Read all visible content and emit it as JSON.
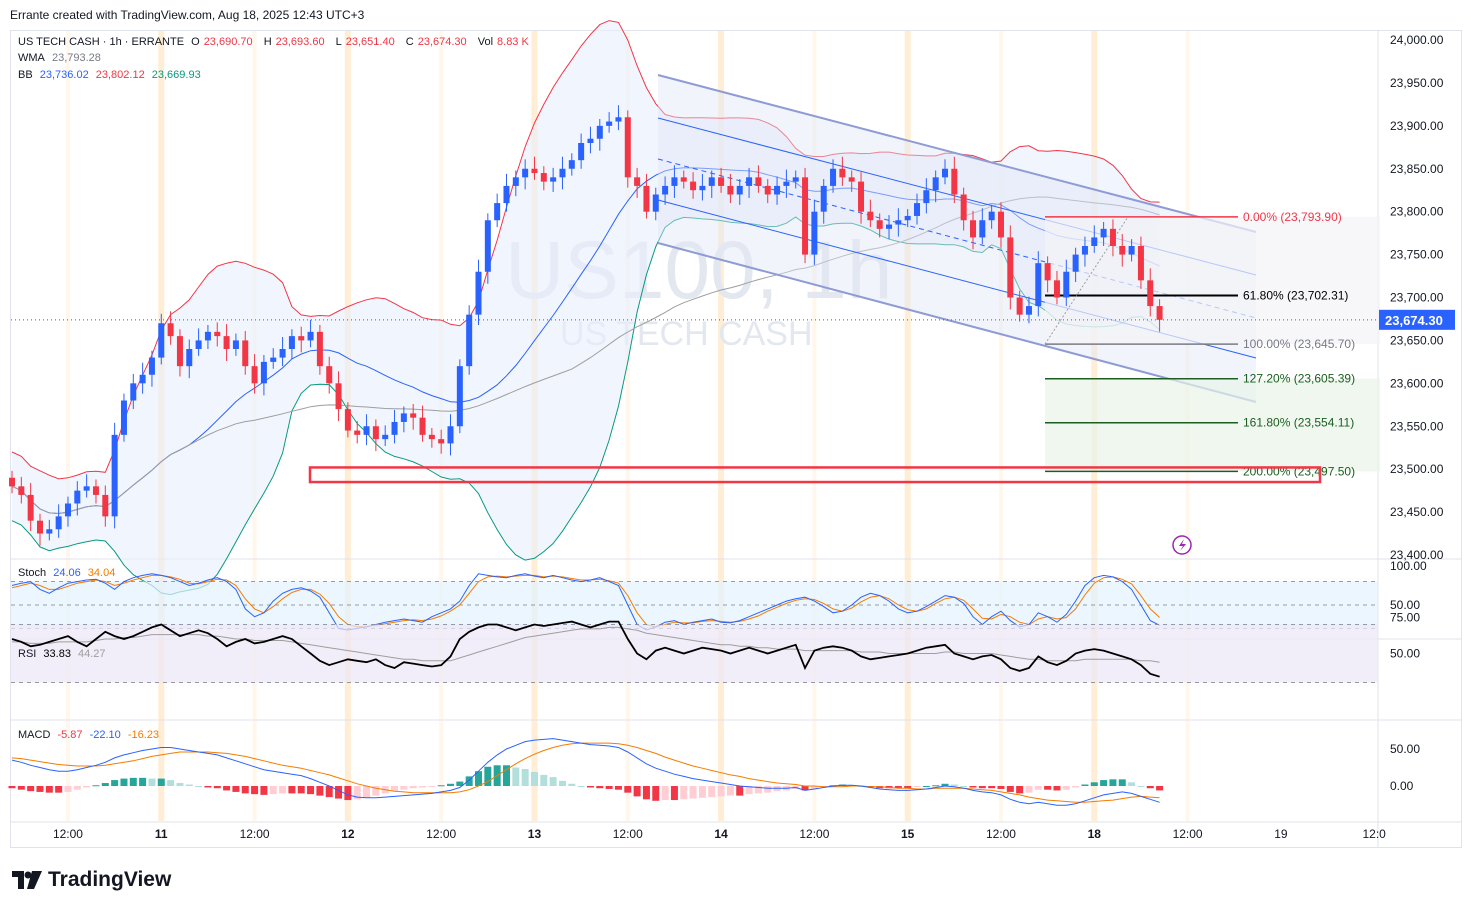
{
  "credit": "Errante created with TradingView.com, Aug 18, 2025 12:43 UTC+3",
  "brand": "TradingView",
  "watermark": {
    "symbol": "US100, 1h",
    "name": "US TECH CASH"
  },
  "legend": {
    "title": "US TECH CASH · 1h · ERRANTE",
    "open_label": "O",
    "open": "23,690.70",
    "high_label": "H",
    "high": "23,693.60",
    "low_label": "L",
    "low": "23,651.40",
    "close_label": "C",
    "close": "23,674.30",
    "vol_label": "Vol",
    "vol": "8.83 K",
    "wma_label": "WMA",
    "wma": "23,793.28",
    "bb_label": "BB",
    "bb_mid": "23,736.02",
    "bb_upper": "23,802.12",
    "bb_lower": "23,669.93",
    "stoch_label": "Stoch",
    "stoch_k": "24.06",
    "stoch_d": "34.04",
    "rsi_label": "RSI",
    "rsi": "33.83",
    "rsi_ma": "44.27",
    "macd_label": "MACD",
    "macd_hist": "-5.87",
    "macd_line": "-22.10",
    "macd_signal": "-16.23"
  },
  "colors": {
    "up": "#2962ff",
    "down": "#f23645",
    "bb_upper": "#f23645",
    "bb_mid": "#2962ff",
    "bb_lower": "#089981",
    "wma": "#9e9e9e",
    "channel": "#8e9bd4",
    "fib_red": "#f23645",
    "fib_black": "#000000",
    "fib_gray": "#787b86",
    "fib_green": "#1b5e20",
    "stoch_k": "#2962ff",
    "stoch_d": "#f57c00",
    "rsi": "#000000",
    "rsi_ma": "#9e9e9e",
    "macd_line": "#2962ff",
    "macd_signal": "#f57c00",
    "hist_pos_strong": "#26a69a",
    "hist_pos_weak": "#b2dfdb",
    "hist_neg_strong": "#f23645",
    "hist_neg_weak": "#ffcdd2",
    "price_tag": "#2962ff",
    "session": "#ffe0b2"
  },
  "price_tag": "23,674.30",
  "chart_data": {
    "type": "candlestick",
    "timeframe": "1h",
    "ylim": [
      23400,
      24000
    ],
    "price_ticks": [
      "24,000.00",
      "23,950.00",
      "23,900.00",
      "23,850.00",
      "23,800.00",
      "23,750.00",
      "23,700.00",
      "23,650.00",
      "23,600.00",
      "23,550.00",
      "23,500.00",
      "23,450.00",
      "23,400.00"
    ],
    "price_tick_values": [
      24000,
      23950,
      23900,
      23850,
      23800,
      23750,
      23700,
      23650,
      23600,
      23550,
      23500,
      23450,
      23400
    ],
    "time_labels": [
      {
        "label": "12:00",
        "i": 6,
        "bold": false
      },
      {
        "label": "11",
        "i": 16,
        "bold": true
      },
      {
        "label": "12:00",
        "i": 26,
        "bold": false
      },
      {
        "label": "12",
        "i": 36,
        "bold": true
      },
      {
        "label": "12:00",
        "i": 46,
        "bold": false
      },
      {
        "label": "13",
        "i": 56,
        "bold": true
      },
      {
        "label": "12:00",
        "i": 66,
        "bold": false
      },
      {
        "label": "14",
        "i": 76,
        "bold": true
      },
      {
        "label": "12:00",
        "i": 86,
        "bold": false
      },
      {
        "label": "15",
        "i": 96,
        "bold": true
      },
      {
        "label": "12:00",
        "i": 106,
        "bold": false
      },
      {
        "label": "18",
        "i": 116,
        "bold": true
      },
      {
        "label": "12:00",
        "i": 126,
        "bold": false
      },
      {
        "label": "19",
        "i": 136,
        "bold": false
      },
      {
        "label": "12:0",
        "i": 146,
        "bold": false
      }
    ],
    "closes": [
      23480,
      23470,
      23440,
      23425,
      23430,
      23445,
      23460,
      23475,
      23480,
      23470,
      23445,
      23540,
      23580,
      23600,
      23610,
      23630,
      23670,
      23655,
      23620,
      23640,
      23650,
      23660,
      23655,
      23640,
      23650,
      23620,
      23600,
      23625,
      23630,
      23640,
      23655,
      23650,
      23660,
      23620,
      23600,
      23570,
      23545,
      23540,
      23550,
      23535,
      23540,
      23555,
      23565,
      23560,
      23540,
      23535,
      23530,
      23550,
      23620,
      23680,
      23730,
      23790,
      23810,
      23830,
      23840,
      23850,
      23845,
      23835,
      23840,
      23850,
      23860,
      23880,
      23885,
      23900,
      23905,
      23910,
      23840,
      23830,
      23800,
      23820,
      23830,
      23840,
      23835,
      23825,
      23830,
      23840,
      23830,
      23820,
      23830,
      23840,
      23830,
      23820,
      23830,
      23835,
      23840,
      23750,
      23800,
      23830,
      23850,
      23840,
      23835,
      23800,
      23790,
      23780,
      23785,
      23790,
      23795,
      23810,
      23825,
      23840,
      23850,
      23820,
      23790,
      23770,
      23790,
      23800,
      23770,
      23700,
      23680,
      23690,
      23740,
      23720,
      23700,
      23730,
      23750,
      23760,
      23770,
      23780,
      23760,
      23750,
      23760,
      23720,
      23690,
      23674
    ],
    "fib_levels": [
      {
        "label": "0.00% (23,793.90)",
        "value": 23793.9,
        "color": "red"
      },
      {
        "label": "61.80% (23,702.31)",
        "value": 23702.31,
        "color": "black"
      },
      {
        "label": "100.00% (23,645.70)",
        "value": 23645.7,
        "color": "gray"
      },
      {
        "label": "127.20% (23,605.39)",
        "value": 23605.39,
        "color": "green"
      },
      {
        "label": "161.80% (23,554.11)",
        "value": 23554.11,
        "color": "green"
      },
      {
        "label": "200.00% (23,497.50)",
        "value": 23497.5,
        "color": "green"
      }
    ],
    "support_zone": [
      23485,
      23502
    ],
    "stoch_ticks": [
      "100.00",
      "50.00"
    ],
    "rsi_ticks": [
      "75.00",
      "50.00"
    ],
    "macd_ticks": [
      "50.00",
      "0.00"
    ],
    "stoch_k": [
      75,
      78,
      80,
      70,
      65,
      72,
      78,
      80,
      82,
      83,
      78,
      70,
      80,
      85,
      88,
      90,
      88,
      85,
      80,
      75,
      78,
      82,
      85,
      80,
      70,
      45,
      35,
      40,
      55,
      65,
      70,
      72,
      68,
      60,
      40,
      20,
      18,
      20,
      22,
      25,
      28,
      30,
      32,
      30,
      28,
      35,
      40,
      45,
      55,
      75,
      90,
      88,
      86,
      85,
      88,
      90,
      87,
      85,
      88,
      85,
      82,
      80,
      82,
      85,
      80,
      75,
      50,
      25,
      18,
      22,
      28,
      30,
      25,
      28,
      30,
      32,
      28,
      27,
      30,
      35,
      40,
      45,
      50,
      55,
      58,
      60,
      55,
      48,
      40,
      42,
      50,
      60,
      65,
      62,
      55,
      45,
      40,
      42,
      48,
      55,
      62,
      60,
      52,
      35,
      25,
      35,
      42,
      30,
      22,
      25,
      40,
      35,
      28,
      38,
      55,
      75,
      85,
      88,
      86,
      80,
      70,
      50,
      30,
      24
    ],
    "stoch_d": [
      72,
      75,
      78,
      75,
      70,
      70,
      74,
      78,
      80,
      82,
      80,
      75,
      78,
      82,
      85,
      88,
      88,
      86,
      83,
      78,
      77,
      80,
      83,
      82,
      75,
      58,
      45,
      40,
      48,
      58,
      66,
      70,
      70,
      64,
      52,
      35,
      25,
      22,
      22,
      24,
      26,
      28,
      30,
      31,
      30,
      32,
      36,
      42,
      50,
      65,
      80,
      86,
      87,
      86,
      87,
      88,
      88,
      86,
      87,
      86,
      84,
      82,
      82,
      83,
      81,
      78,
      62,
      40,
      25,
      22,
      25,
      28,
      27,
      27,
      29,
      30,
      29,
      28,
      29,
      32,
      36,
      42,
      47,
      52,
      56,
      58,
      57,
      52,
      45,
      42,
      46,
      54,
      60,
      62,
      58,
      50,
      44,
      42,
      45,
      52,
      58,
      60,
      56,
      45,
      33,
      32,
      38,
      35,
      28,
      25,
      32,
      35,
      32,
      34,
      45,
      63,
      78,
      85,
      86,
      83,
      77,
      62,
      45,
      34
    ],
    "rsi": [
      60,
      58,
      55,
      56,
      58,
      60,
      62,
      58,
      55,
      60,
      65,
      62,
      60,
      62,
      65,
      68,
      70,
      66,
      62,
      64,
      66,
      64,
      60,
      55,
      58,
      60,
      57,
      58,
      60,
      62,
      60,
      55,
      50,
      45,
      42,
      44,
      46,
      45,
      44,
      46,
      42,
      40,
      44,
      43,
      42,
      41,
      42,
      48,
      60,
      65,
      68,
      70,
      70,
      68,
      66,
      68,
      70,
      69,
      70,
      71,
      72,
      70,
      68,
      70,
      72,
      72,
      60,
      50,
      46,
      52,
      54,
      52,
      50,
      52,
      54,
      53,
      52,
      50,
      52,
      54,
      52,
      50,
      52,
      54,
      56,
      40,
      52,
      54,
      55,
      54,
      52,
      48,
      46,
      47,
      48,
      49,
      50,
      52,
      54,
      55,
      56,
      50,
      48,
      46,
      48,
      49,
      46,
      40,
      38,
      40,
      48,
      44,
      42,
      45,
      50,
      52,
      53,
      52,
      50,
      48,
      46,
      42,
      36,
      34
    ],
    "rsi_ma": [
      58,
      58,
      57,
      57,
      57,
      58,
      58,
      58,
      58,
      59,
      60,
      60,
      61,
      61,
      62,
      63,
      63,
      63,
      63,
      63,
      63,
      62,
      62,
      61,
      60,
      60,
      59,
      59,
      59,
      59,
      58,
      57,
      56,
      55,
      54,
      53,
      52,
      51,
      50,
      49,
      48,
      47,
      46,
      46,
      45,
      45,
      45,
      45,
      47,
      49,
      51,
      53,
      55,
      57,
      59,
      61,
      62,
      63,
      64,
      65,
      66,
      67,
      67,
      67,
      68,
      68,
      67,
      66,
      64,
      63,
      62,
      61,
      60,
      59,
      58,
      57,
      56,
      56,
      55,
      55,
      54,
      54,
      53,
      53,
      53,
      52,
      52,
      52,
      52,
      52,
      52,
      51,
      51,
      51,
      50,
      50,
      50,
      50,
      50,
      50,
      51,
      51,
      50,
      50,
      50,
      50,
      49,
      48,
      47,
      46,
      46,
      45,
      45,
      45,
      45,
      46,
      46,
      46,
      46,
      46,
      46,
      45,
      45,
      44
    ],
    "macd_line": [
      35,
      32,
      28,
      25,
      22,
      20,
      20,
      22,
      25,
      28,
      32,
      38,
      42,
      45,
      48,
      50,
      52,
      52,
      50,
      48,
      46,
      44,
      42,
      38,
      34,
      30,
      26,
      22,
      20,
      18,
      16,
      14,
      10,
      5,
      0,
      -6,
      -12,
      -15,
      -16,
      -16,
      -15,
      -14,
      -13,
      -12,
      -11,
      -10,
      -8,
      -6,
      -2,
      8,
      20,
      32,
      42,
      50,
      55,
      60,
      62,
      63,
      64,
      62,
      60,
      58,
      56,
      55,
      54,
      52,
      46,
      38,
      30,
      24,
      20,
      16,
      13,
      10,
      8,
      6,
      4,
      2,
      0,
      -1,
      -2,
      -3,
      -3,
      -3,
      -2,
      -6,
      -4,
      -2,
      0,
      1,
      1,
      0,
      -2,
      -4,
      -5,
      -6,
      -6,
      -5,
      -4,
      -2,
      0,
      -1,
      -3,
      -6,
      -8,
      -9,
      -12,
      -18,
      -22,
      -24,
      -22,
      -24,
      -26,
      -26,
      -24,
      -20,
      -16,
      -12,
      -10,
      -8,
      -10,
      -14,
      -18,
      -22
    ],
    "macd_signal": [
      38,
      37,
      35,
      33,
      31,
      29,
      28,
      27,
      27,
      27,
      28,
      30,
      32,
      34,
      37,
      40,
      42,
      44,
      46,
      46,
      46,
      46,
      45,
      44,
      42,
      40,
      37,
      34,
      31,
      28,
      26,
      24,
      21,
      18,
      15,
      11,
      7,
      3,
      0,
      -3,
      -5,
      -7,
      -8,
      -9,
      -9,
      -9,
      -9,
      -9,
      -8,
      -5,
      0,
      6,
      14,
      22,
      30,
      37,
      43,
      48,
      52,
      55,
      57,
      58,
      58,
      58,
      58,
      57,
      55,
      52,
      48,
      44,
      39,
      35,
      31,
      27,
      24,
      21,
      18,
      15,
      13,
      10,
      8,
      6,
      4,
      3,
      2,
      0,
      0,
      -1,
      -1,
      -1,
      0,
      0,
      -1,
      -1,
      -2,
      -3,
      -3,
      -4,
      -4,
      -3,
      -3,
      -3,
      -3,
      -4,
      -5,
      -6,
      -8,
      -10,
      -12,
      -15,
      -17,
      -19,
      -20,
      -21,
      -22,
      -22,
      -21,
      -20,
      -19,
      -17,
      -15,
      -14,
      -15,
      -16
    ]
  }
}
